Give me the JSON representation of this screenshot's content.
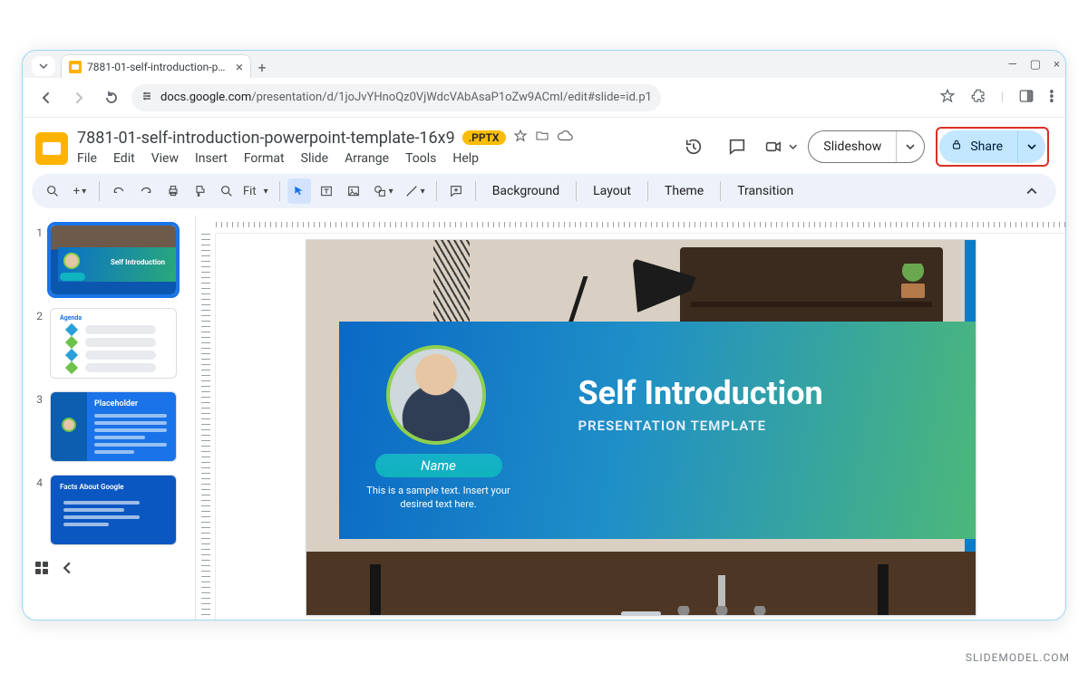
{
  "browser": {
    "tab_title": "7881-01-self-introduction-pow",
    "url_host": "docs.google.com",
    "url_path": "/presentation/d/1joJvYHnoQz0VjWdcVAbAsaP1oZw9ACmI/edit#slide=id.p1"
  },
  "doc": {
    "title": "7881-01-self-introduction-powerpoint-template-16x9",
    "format_badge": ".PPTX"
  },
  "menubar": {
    "file": "File",
    "edit": "Edit",
    "view": "View",
    "insert": "Insert",
    "format": "Format",
    "slide": "Slide",
    "arrange": "Arrange",
    "tools": "Tools",
    "help": "Help"
  },
  "actions": {
    "slideshow": "Slideshow",
    "share": "Share"
  },
  "toolbar": {
    "zoom_label": "Fit",
    "background": "Background",
    "layout": "Layout",
    "theme": "Theme",
    "transition": "Transition"
  },
  "thumbs": {
    "n1": "1",
    "n2": "2",
    "n3": "3",
    "n4": "4",
    "t1_title": "Self Introduction",
    "t2_header": "Agenda",
    "t3_title": "Placeholder",
    "t4_title": "Facts About Google"
  },
  "slide": {
    "headline": "Self Introduction",
    "subhead": "PRESENTATION TEMPLATE",
    "name_chip": "Name",
    "sample": "This is a sample text. Insert your desired text here."
  },
  "watermark": "SLIDEMODEL.COM"
}
